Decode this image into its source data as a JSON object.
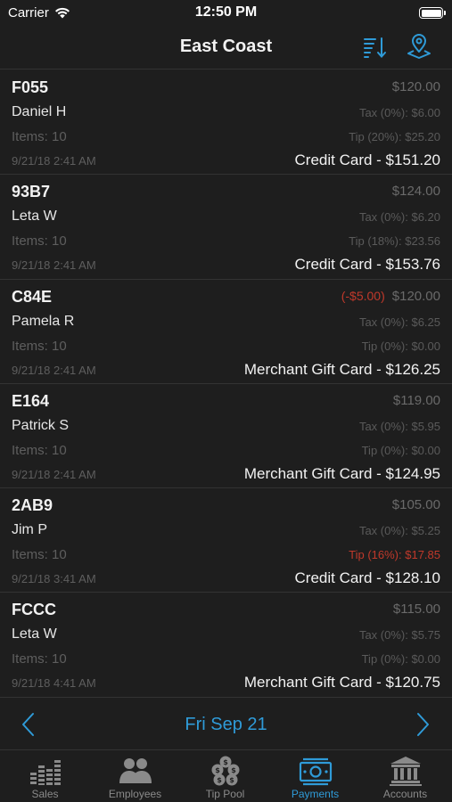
{
  "status_bar": {
    "carrier": "Carrier",
    "time": "12:50 PM"
  },
  "nav": {
    "title": "East Coast"
  },
  "payments": [
    {
      "code": "F055",
      "name": "Daniel H",
      "items": "Items: 10",
      "date": "9/21/18 2:41 AM",
      "discount": "",
      "subtotal": "$120.00",
      "tax": "Tax (0%): $6.00",
      "tip": "Tip (20%): $25.20",
      "tip_warning": false,
      "total": "Credit Card - $151.20"
    },
    {
      "code": "93B7",
      "name": "Leta W",
      "items": "Items: 10",
      "date": "9/21/18 2:41 AM",
      "discount": "",
      "subtotal": "$124.00",
      "tax": "Tax (0%): $6.20",
      "tip": "Tip (18%): $23.56",
      "tip_warning": false,
      "total": "Credit Card - $153.76"
    },
    {
      "code": "C84E",
      "name": "Pamela R",
      "items": "Items: 10",
      "date": "9/21/18 2:41 AM",
      "discount": "(-$5.00)",
      "subtotal": "$120.00",
      "tax": "Tax (0%): $6.25",
      "tip": "Tip (0%): $0.00",
      "tip_warning": false,
      "total": "Merchant Gift Card - $126.25"
    },
    {
      "code": "E164",
      "name": "Patrick S",
      "items": "Items: 10",
      "date": "9/21/18 2:41 AM",
      "discount": "",
      "subtotal": "$119.00",
      "tax": "Tax (0%): $5.95",
      "tip": "Tip (0%): $0.00",
      "tip_warning": false,
      "total": "Merchant Gift Card - $124.95"
    },
    {
      "code": "2AB9",
      "name": "Jim P",
      "items": "Items: 10",
      "date": "9/21/18 3:41 AM",
      "discount": "",
      "subtotal": "$105.00",
      "tax": "Tax (0%): $5.25",
      "tip": "Tip (16%): $17.85",
      "tip_warning": true,
      "total": "Credit Card - $128.10"
    },
    {
      "code": "FCCC",
      "name": "Leta W",
      "items": "Items: 10",
      "date": "9/21/18 4:41 AM",
      "discount": "",
      "subtotal": "$115.00",
      "tax": "Tax (0%): $5.75",
      "tip": "Tip (0%): $0.00",
      "tip_warning": false,
      "total": "Merchant Gift Card - $120.75"
    }
  ],
  "date_nav": {
    "label": "Fri Sep 21"
  },
  "tabs": [
    {
      "label": "Sales",
      "icon": "sales-chart-icon",
      "active": false
    },
    {
      "label": "Employees",
      "icon": "employees-icon",
      "active": false
    },
    {
      "label": "Tip Pool",
      "icon": "tip-pool-icon",
      "active": false
    },
    {
      "label": "Payments",
      "icon": "payments-icon",
      "active": true
    },
    {
      "label": "Accounts",
      "icon": "accounts-bank-icon",
      "active": false
    }
  ],
  "colors": {
    "background": "#1e1e1e",
    "accent": "#2f9bd8",
    "warning": "#c0392b",
    "muted": "#5e5e5e"
  }
}
